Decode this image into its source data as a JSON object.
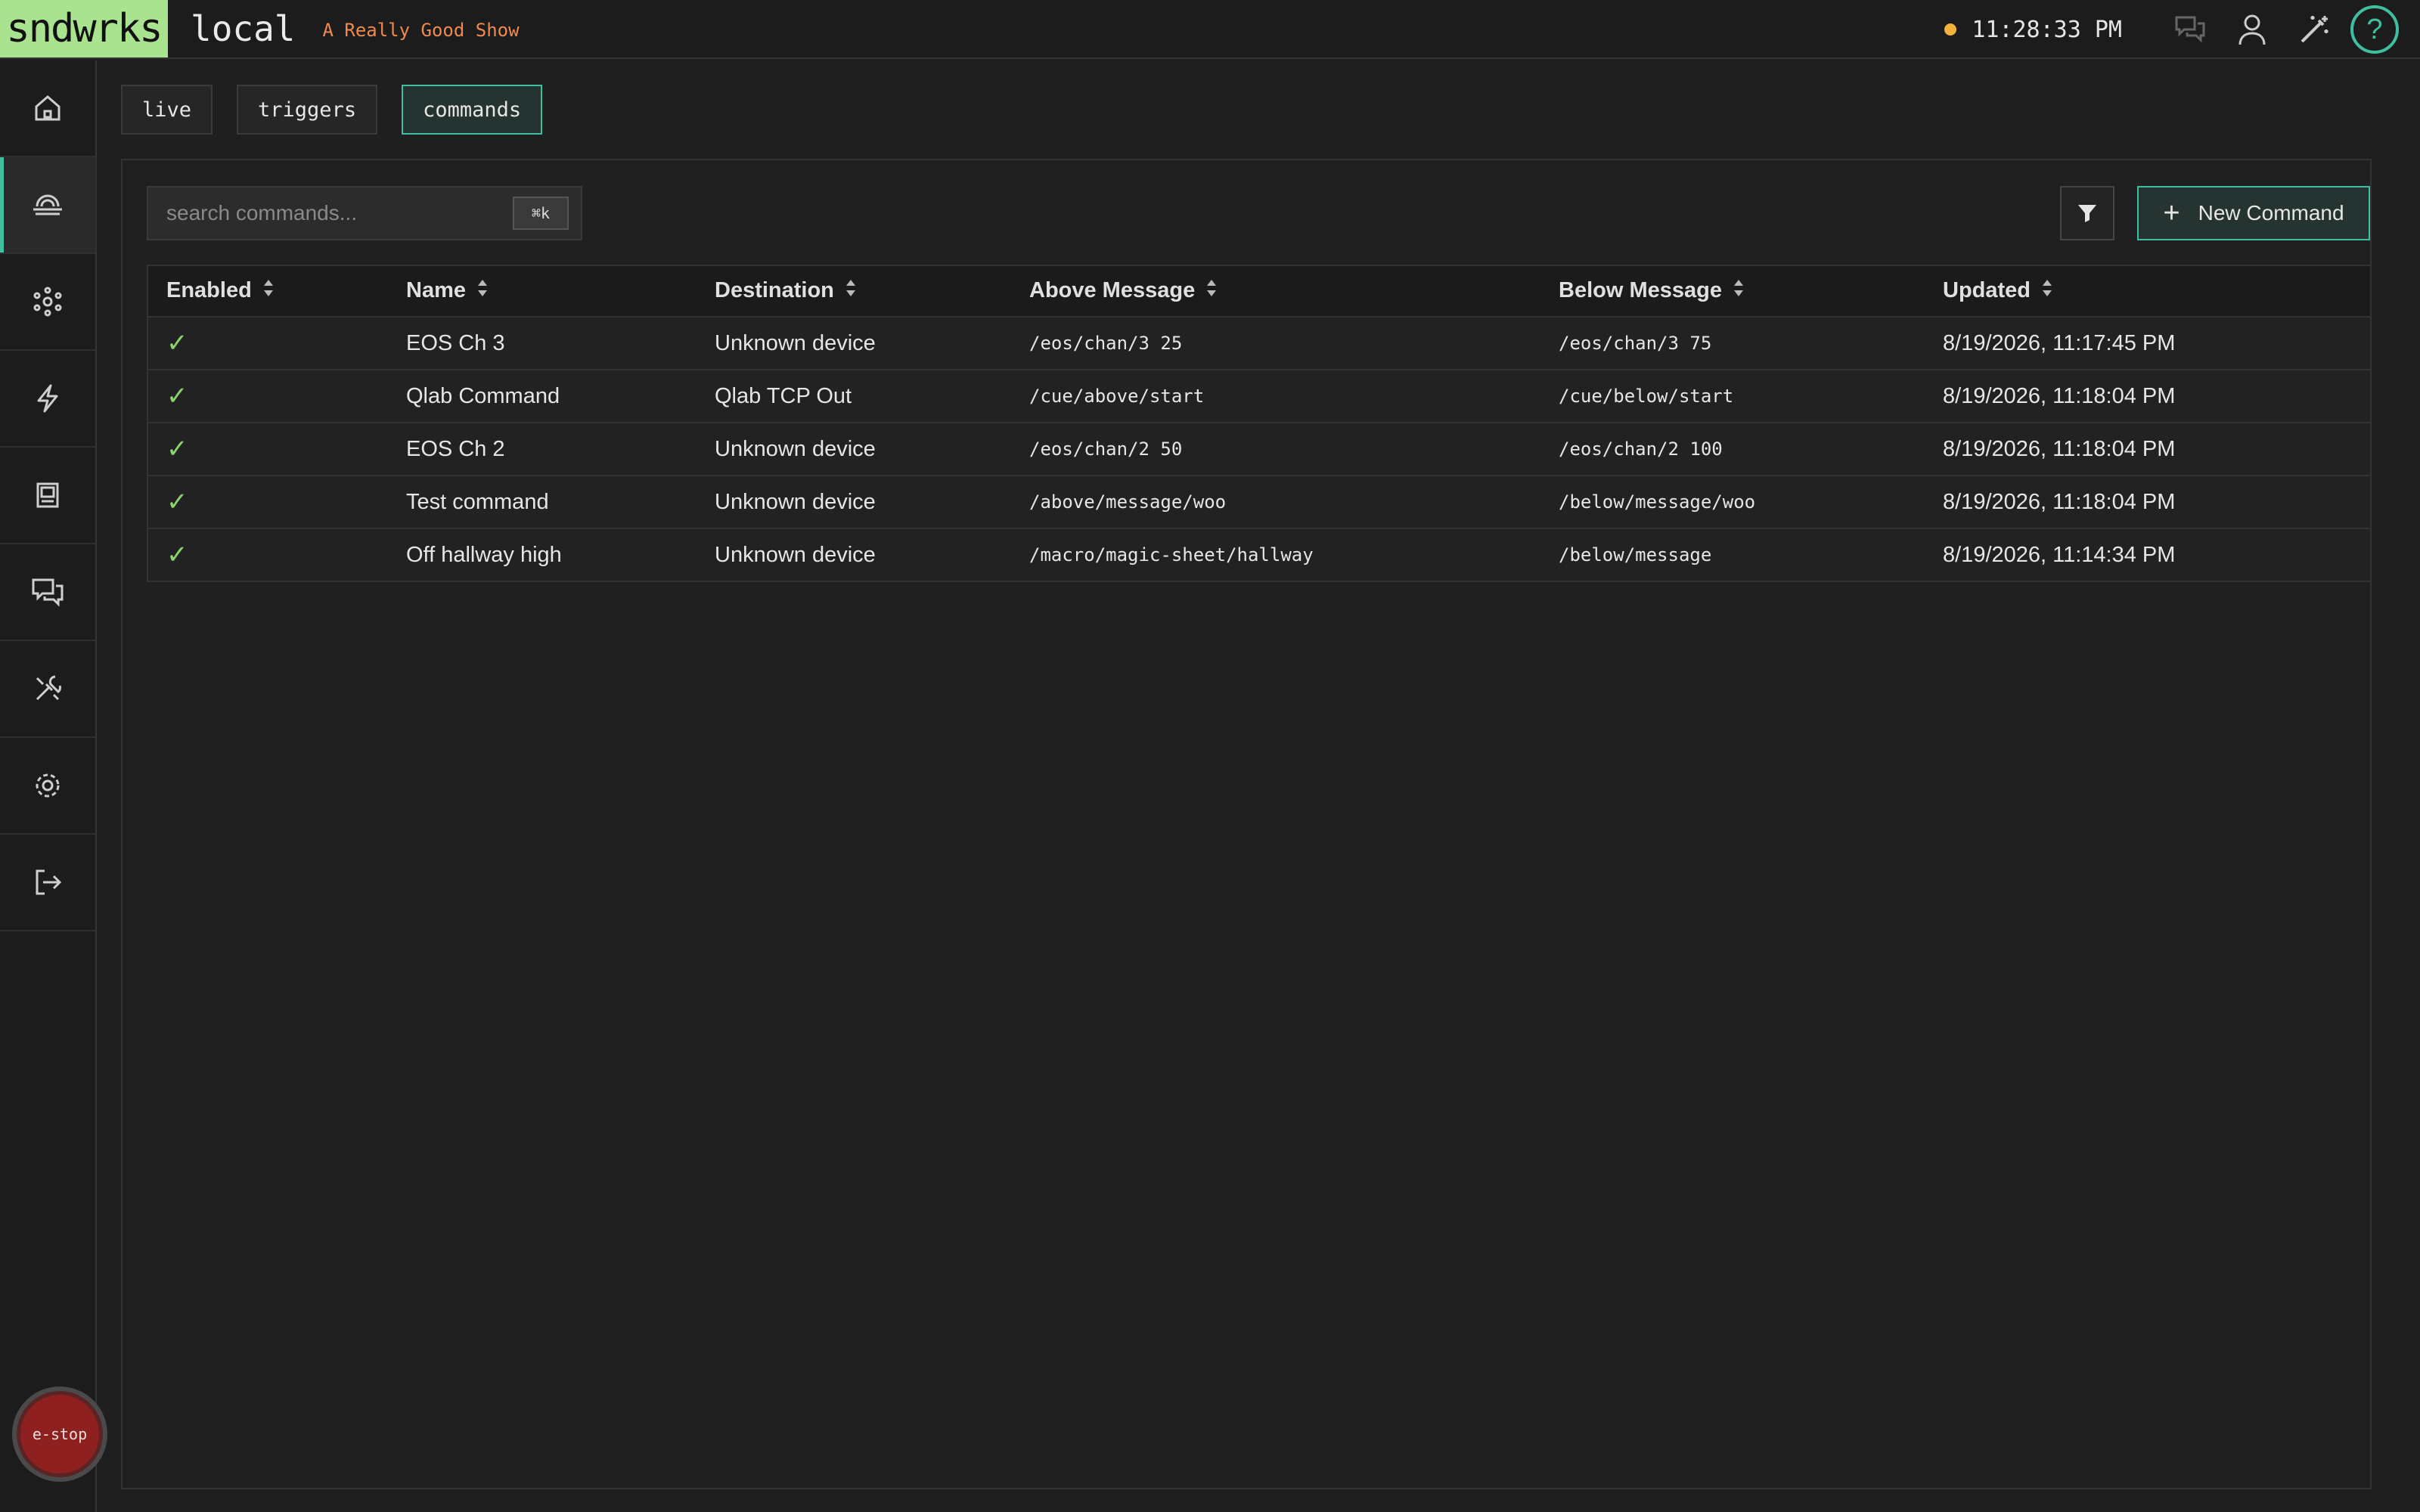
{
  "header": {
    "logo": "sndwrks",
    "environment": "local",
    "show_name": "A Really Good Show",
    "clock": "11:28:33 PM",
    "status_color": "#f2b33d",
    "icons": [
      "chat-icon",
      "user-icon",
      "magic-wand-icon",
      "help-icon"
    ],
    "help_symbol": "?"
  },
  "sidebar": {
    "items": [
      {
        "name": "home-icon",
        "active": false
      },
      {
        "name": "commands-icon",
        "active": true
      },
      {
        "name": "network-icon",
        "active": false
      },
      {
        "name": "triggers-icon",
        "active": false
      },
      {
        "name": "display-icon",
        "active": false
      },
      {
        "name": "chat-icon",
        "active": false
      },
      {
        "name": "tools-icon",
        "active": false
      },
      {
        "name": "settings-icon",
        "active": false
      },
      {
        "name": "logout-icon",
        "active": false
      }
    ],
    "estop_label": "e-stop"
  },
  "tabs": [
    {
      "label": "live",
      "active": false
    },
    {
      "label": "triggers",
      "active": false
    },
    {
      "label": "commands",
      "active": true
    }
  ],
  "toolbar": {
    "search_placeholder": "search commands...",
    "search_shortcut": "⌘k",
    "filter_icon": "filter-icon",
    "new_label": "New Command",
    "new_symbol": "+"
  },
  "table": {
    "columns": [
      "Enabled",
      "Name",
      "Destination",
      "Above Message",
      "Below Message",
      "Updated"
    ],
    "rows": [
      {
        "enabled": "✓",
        "name": "EOS Ch 3",
        "destination": "Unknown device",
        "above": "/eos/chan/3 25",
        "below": "/eos/chan/3 75",
        "updated": "8/19/2026, 11:17:45 PM"
      },
      {
        "enabled": "✓",
        "name": "Qlab Command",
        "destination": "Qlab TCP Out",
        "above": "/cue/above/start",
        "below": "/cue/below/start",
        "updated": "8/19/2026, 11:18:04 PM"
      },
      {
        "enabled": "✓",
        "name": "EOS Ch 2",
        "destination": "Unknown device",
        "above": "/eos/chan/2 50",
        "below": "/eos/chan/2 100",
        "updated": "8/19/2026, 11:18:04 PM"
      },
      {
        "enabled": "✓",
        "name": "Test command",
        "destination": "Unknown device",
        "above": "/above/message/woo",
        "below": "/below/message/woo",
        "updated": "8/19/2026, 11:18:04 PM"
      },
      {
        "enabled": "✓",
        "name": "Off hallway high",
        "destination": "Unknown device",
        "above": "/macro/magic-sheet/hallway",
        "below": "/below/message",
        "updated": "8/19/2026, 11:14:34 PM"
      }
    ]
  },
  "colors": {
    "accent": "#3fbf9f",
    "logo_bg": "#a9e38f",
    "show_name": "#ef8a4e",
    "check": "#8bd46a",
    "estop": "#8e2020"
  }
}
